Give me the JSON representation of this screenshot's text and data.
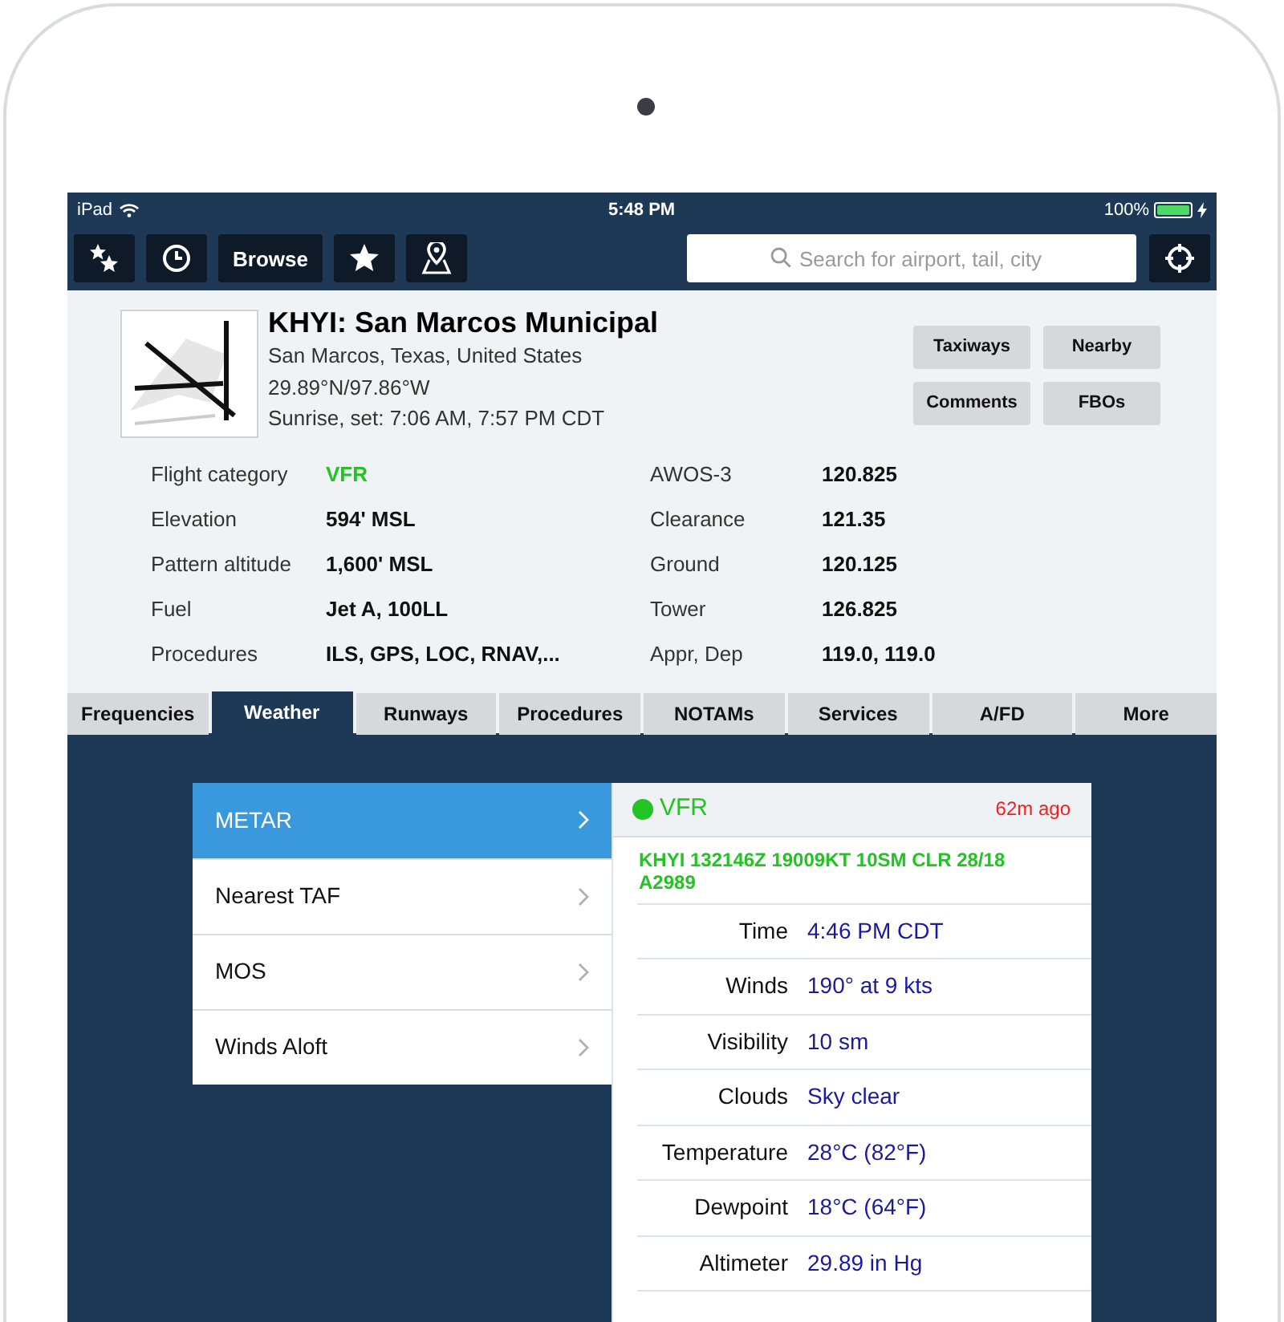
{
  "status_bar": {
    "device": "iPad",
    "time": "5:48 PM",
    "battery": {
      "text": "100%",
      "level": 1
    }
  },
  "toolbar": {
    "buttons": [
      {
        "kind": "favorites"
      },
      {
        "kind": "recent"
      },
      {
        "kind": "text",
        "label": "Browse"
      },
      {
        "kind": "star"
      },
      {
        "kind": "pin"
      }
    ],
    "search": {
      "placeholder": "Search for airport, tail, city"
    }
  },
  "airport": {
    "title": "KHYI: San Marcos Municipal",
    "location": "San Marcos, Texas, United States",
    "coordinates": "29.89°N/97.86°W",
    "sun": "Sunrise, set: 7:06 AM, 7:57 PM CDT",
    "buttons": [
      "Taxiways",
      "Nearby",
      "Comments",
      "FBOs"
    ]
  },
  "info": [
    {
      "label": "Flight category",
      "value": "VFR",
      "color": "#22c322"
    },
    {
      "label": "AWOS-3",
      "value": "120.825"
    },
    {
      "label": "Elevation",
      "value": "594' MSL"
    },
    {
      "label": "Clearance",
      "value": "121.35"
    },
    {
      "label": "Pattern altitude",
      "value": "1,600' MSL"
    },
    {
      "label": "Ground",
      "value": "120.125"
    },
    {
      "label": "Fuel",
      "value": "Jet A, 100LL"
    },
    {
      "label": "Tower",
      "value": "126.825"
    },
    {
      "label": "Procedures",
      "value": "ILS, GPS, LOC, RNAV,..."
    },
    {
      "label": "Appr, Dep",
      "value": "119.0, 119.0"
    }
  ],
  "tabs": [
    {
      "label": "Frequencies",
      "selected": false
    },
    {
      "label": "Weather",
      "selected": true
    },
    {
      "label": "Runways",
      "selected": false
    },
    {
      "label": "Procedures",
      "selected": false
    },
    {
      "label": "NOTAMs",
      "selected": false
    },
    {
      "label": "Services",
      "selected": false
    },
    {
      "label": "A/FD",
      "selected": false
    },
    {
      "label": "More",
      "selected": false
    }
  ],
  "weather_menu": [
    {
      "label": "METAR",
      "selected": true
    },
    {
      "label": "Nearest TAF",
      "selected": false
    },
    {
      "label": "MOS",
      "selected": false
    },
    {
      "label": "Winds Aloft",
      "selected": false
    }
  ],
  "metar": {
    "category": "VFR",
    "color": "#22c322",
    "age": "62m ago",
    "raw": "KHYI 132146Z 19009KT 10SM CLR 28/18 A2989",
    "rows": [
      {
        "label": "Time",
        "value": "4:46 PM CDT"
      },
      {
        "label": "Winds",
        "value": "190° at 9 kts"
      },
      {
        "label": "Visibility",
        "value": "10 sm"
      },
      {
        "label": "Clouds",
        "value": "Sky clear"
      },
      {
        "label": "Temperature",
        "value": "28°C (82°F)"
      },
      {
        "label": "Dewpoint",
        "value": "18°C (64°F)"
      },
      {
        "label": "Altimeter",
        "value": "29.89 in Hg"
      }
    ]
  }
}
